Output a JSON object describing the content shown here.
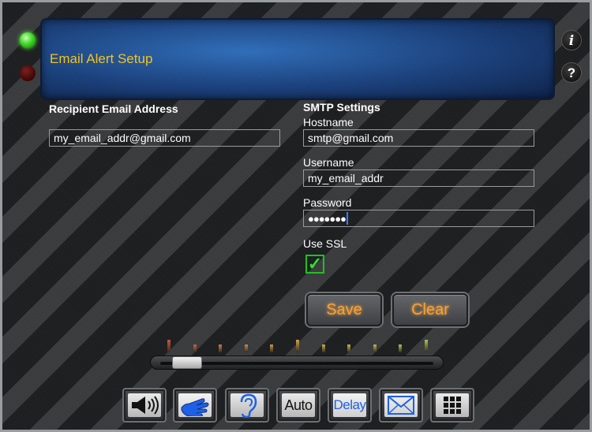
{
  "header": {
    "title": "Email Alert Setup"
  },
  "side_buttons": {
    "info": "i",
    "help": "?"
  },
  "recipient": {
    "label": "Recipient Email Address",
    "value": "my_email_addr@gmail.com"
  },
  "smtp": {
    "section_label": "SMTP Settings",
    "hostname_label": "Hostname",
    "hostname_value": "smtp@gmail.com",
    "username_label": "Username",
    "username_value": "my_email_addr",
    "password_label": "Password",
    "password_value": "●●●●●●●",
    "ssl_label": "Use SSL",
    "ssl_checked": true,
    "check_glyph": "✓"
  },
  "actions": {
    "save_label": "Save",
    "clear_label": "Clear"
  },
  "slider": {
    "level": 0.05
  },
  "toolbar": {
    "auto_label": "Auto",
    "delay_label": "Delay",
    "icons": [
      "speaker-icon",
      "hand-icon",
      "ear-icon",
      "auto-text",
      "delay-text",
      "envelope-icon",
      "grid-icon"
    ]
  },
  "colors": {
    "accent_text": "#f2c21d",
    "button_text": "#ff9f2a",
    "check_green": "#2ee02e",
    "tick_gradient": [
      "#c8553f",
      "#c8663f",
      "#c97a44",
      "#c98a4a",
      "#c9964d",
      "#c9a24e",
      "#c2ae4e",
      "#bcb64d",
      "#b4bd4f",
      "#a9c24f",
      "#9fc650"
    ]
  }
}
